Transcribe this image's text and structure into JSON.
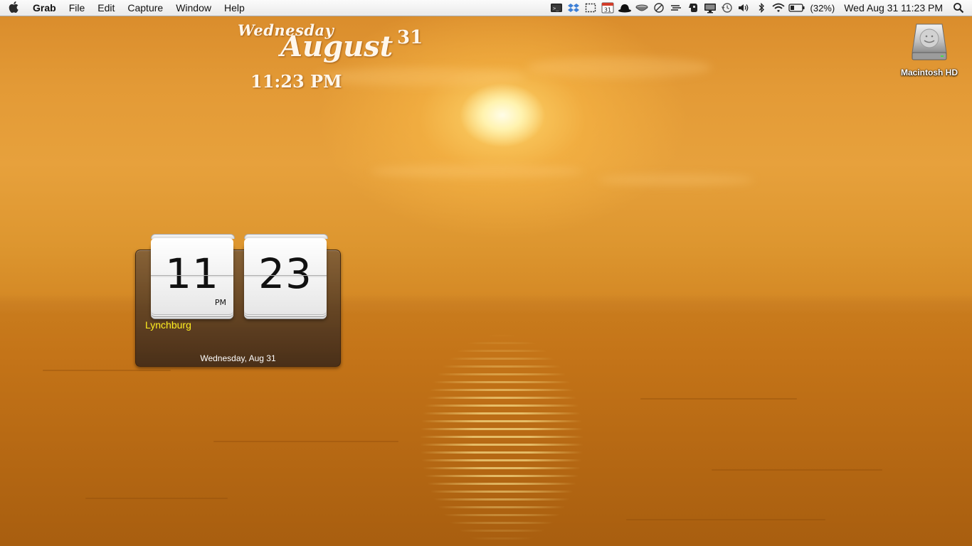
{
  "menubar": {
    "apple_icon": "apple-icon",
    "app_name": "Grab",
    "menus": [
      "File",
      "Edit",
      "Capture",
      "Window",
      "Help"
    ],
    "status_icons": [
      "terminal-icon",
      "dropbox-icon",
      "selection-icon",
      "calendar-icon",
      "bowler-hat-icon",
      "bowl-icon",
      "slash-circle-icon",
      "script-icon",
      "evernote-icon",
      "display-icon",
      "time-machine-icon",
      "volume-icon",
      "bluetooth-icon",
      "wifi-icon",
      "battery-icon",
      "spotlight-icon"
    ],
    "calendar_badge": "31",
    "battery_percent": "(32%)",
    "clock": "Wed Aug 31  11:23 PM"
  },
  "desktop_date_widget": {
    "day": "Wednesday",
    "month": "August",
    "date": "31",
    "time": "11:23 PM"
  },
  "desktop_icons": [
    {
      "label": "Macintosh HD",
      "icon": "hard-drive-icon"
    }
  ],
  "flip_clock": {
    "hours": "11",
    "minutes": "23",
    "ampm": "PM",
    "city": "Lynchburg",
    "date": "Wednesday, Aug 31"
  },
  "colors": {
    "city_text": "#ffee20",
    "sky": "#e39a36",
    "sea": "#b86a14"
  }
}
